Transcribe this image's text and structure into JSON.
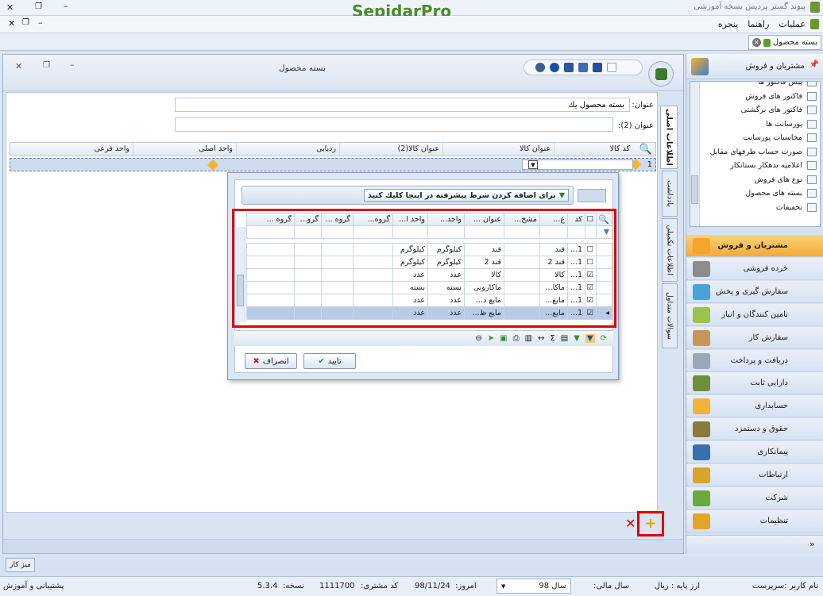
{
  "app": {
    "title": "پیوند گستر پردیس نسخه آموزشی",
    "logo_text": "SepidarPro",
    "menu": [
      "عملیات",
      "راهنما",
      "پنجره"
    ],
    "doc_tab": "بسته محصول"
  },
  "window": {
    "title": "بسته محصول",
    "title_label": "عنوان:",
    "title_value": "بسته محصول یك",
    "title2_label": "عنوان (2):",
    "title2_value": "",
    "side_tabs": [
      "اطلاعات اصلی",
      "یادداشت",
      "اطلاعات تكمیلی",
      "سوالات متداول"
    ],
    "grid_headers": [
      "كد كالا",
      "عنوان كالا",
      "عنوان كالا(2)",
      "ردیابی",
      "واحد اصلی",
      "واحد فرعی"
    ],
    "row_index": "1"
  },
  "popup": {
    "filter_hint": "برای اضافه كردن شرط پیشرفته در اینجا كلیك كنید",
    "headers": [
      "كد",
      "ع...",
      "مشخ...",
      "عنوان ...",
      "واحد...",
      "واحد ا...",
      "گروه...",
      "گروه ...",
      "گرو...",
      "گروه ..."
    ],
    "rows": [
      {
        "checked": false,
        "code": "1...",
        "title": "قند",
        "desc": "",
        "name": "قند",
        "unit": "كیلوگرم",
        "unit2": "كیلوگرم",
        "selected": false
      },
      {
        "checked": false,
        "code": "1...",
        "title": "قند 2",
        "desc": "",
        "name": "قند 2",
        "unit": "كیلوگرم",
        "unit2": "كیلوگرم",
        "selected": false
      },
      {
        "checked": true,
        "code": "1...",
        "title": "كالا",
        "desc": "",
        "name": "كالا",
        "unit": "عدد",
        "unit2": "عدد",
        "selected": false
      },
      {
        "checked": true,
        "code": "1...",
        "title": "ماكا...",
        "desc": "",
        "name": "ماكارونی",
        "unit": "بسته",
        "unit2": "بسته",
        "selected": false
      },
      {
        "checked": true,
        "code": "1...",
        "title": "مایع...",
        "desc": "",
        "name": "مایع د...",
        "unit": "عدد",
        "unit2": "عدد",
        "selected": false
      },
      {
        "checked": true,
        "code": "1...",
        "title": "مایع...",
        "desc": "",
        "name": "مایع ظ...",
        "unit": "عدد",
        "unit2": "عدد",
        "selected": true
      }
    ],
    "ok_label": "تایید",
    "cancel_label": "انصراف"
  },
  "sidebar": {
    "header": "مشتریان و فروش",
    "tree_items": [
      "پیش فاكتور ها",
      "فاكتور های فروش",
      "فاكتور های برگشتی",
      "پورسانت ها",
      "محاسبات پورسانت",
      "صورت حساب طرفهای مقابل",
      "اعلامیه بدهكار بستانكار",
      "نوع های فروش",
      "بسته های محصول",
      "تخفیفات"
    ],
    "nav": [
      "مشتریان و فروش",
      "خرده فروشی",
      "سفارش گیری و پخش",
      "تامین كنندگان و انبار",
      "سفارش كار",
      "دریافت و پرداخت",
      "دارایی ثابت",
      "حسابداری",
      "حقوق و دستمزد",
      "پیمانكاری",
      "ارتباطات",
      "شركت",
      "تنظیمات"
    ]
  },
  "taskbar": {
    "desk_label": "میز كار"
  },
  "status": {
    "user": "نام كاربر :سرپرست",
    "currency": "ارز پایه : ریال",
    "fiscal_label": "سال مالی:",
    "fiscal_value": "سال 98",
    "today_label": "امروز:",
    "today_value": "98/11/24",
    "customer_label": "كد مشتری:",
    "customer_value": "1111700",
    "version_label": "نسخه:",
    "version_value": "5.3.4",
    "support": "پشتیبانی و آموزش"
  },
  "colors": {
    "accent_orange": "#f7b13c",
    "highlight_red": "#e00000",
    "selected_row": "#b9cbe5"
  }
}
